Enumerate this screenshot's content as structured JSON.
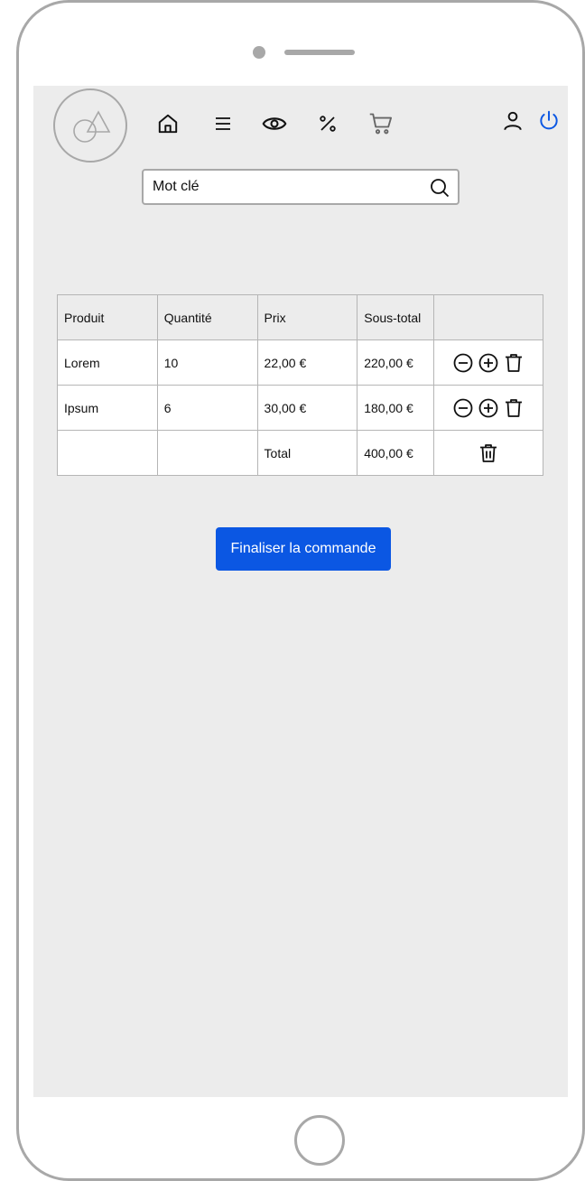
{
  "header": {
    "nav": [
      {
        "icon": "home-icon"
      },
      {
        "icon": "menu-icon"
      },
      {
        "icon": "eye-icon"
      },
      {
        "icon": "percent-icon"
      },
      {
        "icon": "cart-icon"
      }
    ],
    "account_icon": "user-icon",
    "power_icon": "power-icon"
  },
  "search": {
    "placeholder": "Mot clé",
    "icon": "search-icon"
  },
  "cart": {
    "headers": [
      "Produit",
      "Quantité",
      "Prix",
      "Sous-total",
      ""
    ],
    "rows": [
      {
        "product": "Lorem",
        "quantity": "10",
        "price": "22,00 €",
        "subtotal": "220,00 €"
      },
      {
        "product": "Ipsum",
        "quantity": "6",
        "price": "30,00 €",
        "subtotal": "180,00 €"
      }
    ],
    "total_label": "Total",
    "total_value": "400,00 €"
  },
  "checkout": {
    "label": "Finaliser la commande"
  },
  "colors": {
    "accent": "#0b57e3",
    "screen_bg": "#ececec",
    "frame": "#a8a8a8"
  }
}
